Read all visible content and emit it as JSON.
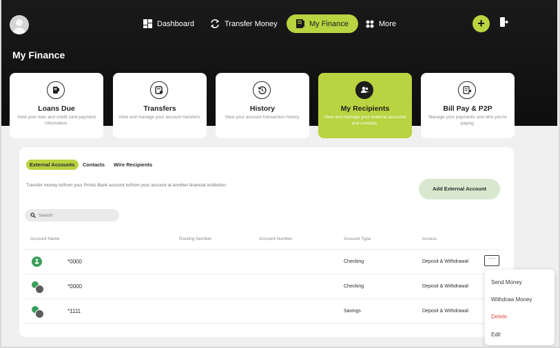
{
  "nav": {
    "dashboard": "Dashboard",
    "transfer": "Transfer Money",
    "finance": "My Finance",
    "more": "More"
  },
  "page_title": "My Finance",
  "cards": [
    {
      "title": "Loans Due",
      "desc": "View your loan and credit card payment information.",
      "icon": "loan-document-icon"
    },
    {
      "title": "Transfers",
      "desc": "View and manage your account transfers.",
      "icon": "transfer-card-icon"
    },
    {
      "title": "History",
      "desc": "View your account transaction history.",
      "icon": "history-clock-icon"
    },
    {
      "title": "My Recipients",
      "desc": "View and manage your external accounts and contacts.",
      "icon": "recipients-users-icon"
    },
    {
      "title": "Bill Pay & P2P",
      "desc": "Manage your payments and who you're paying.",
      "icon": "bill-pay-icon"
    }
  ],
  "tabs": [
    "External Accounts",
    "Contacts",
    "Wire Recipients"
  ],
  "description": "Transfer money to/from your Primis Bank account to/from your account at another financial institution.",
  "add_button": "Add External Account",
  "search": {
    "placeholder": "Search"
  },
  "table": {
    "headers": [
      "Account Name",
      "Routing Number",
      "Account Number",
      "Account Type",
      "Access"
    ],
    "rows": [
      {
        "name": "*0000",
        "type": "Checking",
        "access": "Deposit & Withdrawal"
      },
      {
        "name": "*0000",
        "type": "Checking",
        "access": "Deposit & Withdrawal"
      },
      {
        "name": "*1111",
        "type": "Savings",
        "access": "Deposit & Withdrawal"
      }
    ]
  },
  "menu": [
    "Send Money",
    "Withdraw Money",
    "Delete",
    "Edit"
  ],
  "more_label": "···",
  "plus_label": "+",
  "colors": {
    "accent": "#b9d341",
    "danger": "#e34c4c",
    "hero": "#111111"
  }
}
